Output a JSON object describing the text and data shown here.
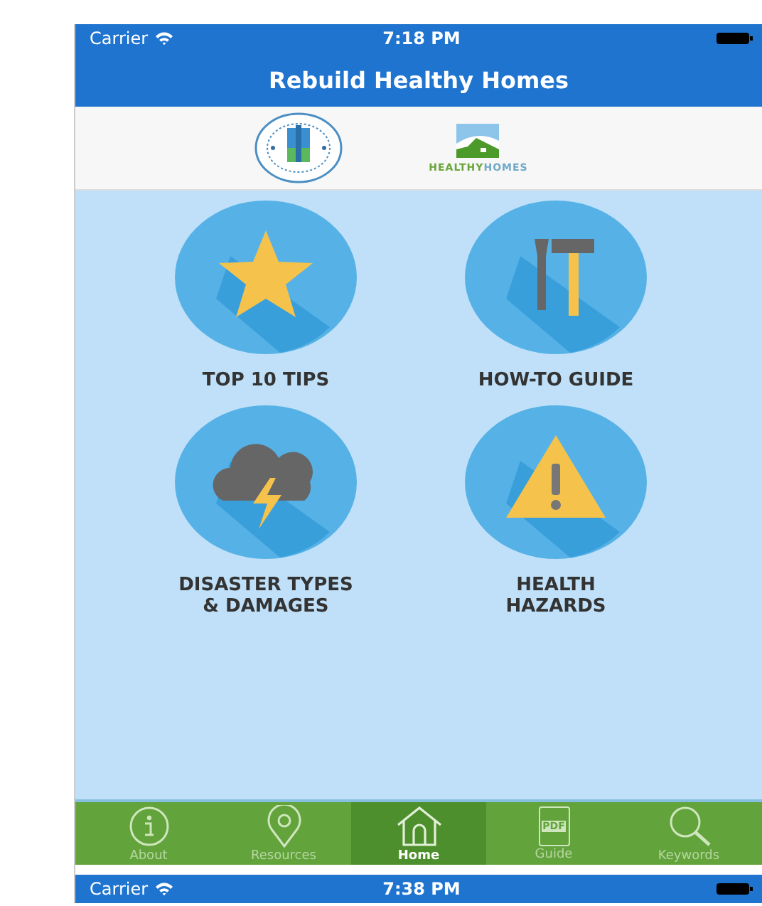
{
  "status_bar": {
    "carrier": "Carrier",
    "time": "7:18 PM"
  },
  "nav_bar": {
    "title": "Rebuild Healthy Homes"
  },
  "logos": {
    "healthy_homes_parts": [
      {
        "text": "HEALTHY",
        "color": "#6aa63a"
      },
      {
        "text": "HOMES",
        "color": "#6fa8c8"
      }
    ]
  },
  "tiles": [
    {
      "kind": "star",
      "lines": [
        "TOP 10 TIPS"
      ]
    },
    {
      "kind": "tools",
      "lines": [
        "HOW-TO GUIDE"
      ]
    },
    {
      "kind": "storm",
      "lines": [
        "DISASTER TYPES",
        "& DAMAGES"
      ]
    },
    {
      "kind": "warning",
      "lines": [
        "HEALTH",
        "HAZARDS"
      ]
    }
  ],
  "tab_bar": [
    {
      "kind": "info",
      "label": "About",
      "selected": false
    },
    {
      "kind": "pin",
      "label": "Resources",
      "selected": false
    },
    {
      "kind": "home",
      "label": "Home",
      "selected": true
    },
    {
      "kind": "pdf",
      "label": "Guide",
      "icon_text": "PDF",
      "selected": false
    },
    {
      "kind": "search",
      "label": "Keywords",
      "selected": false
    }
  ],
  "second_status_bar": {
    "carrier": "Carrier",
    "time": "7:38 PM"
  }
}
